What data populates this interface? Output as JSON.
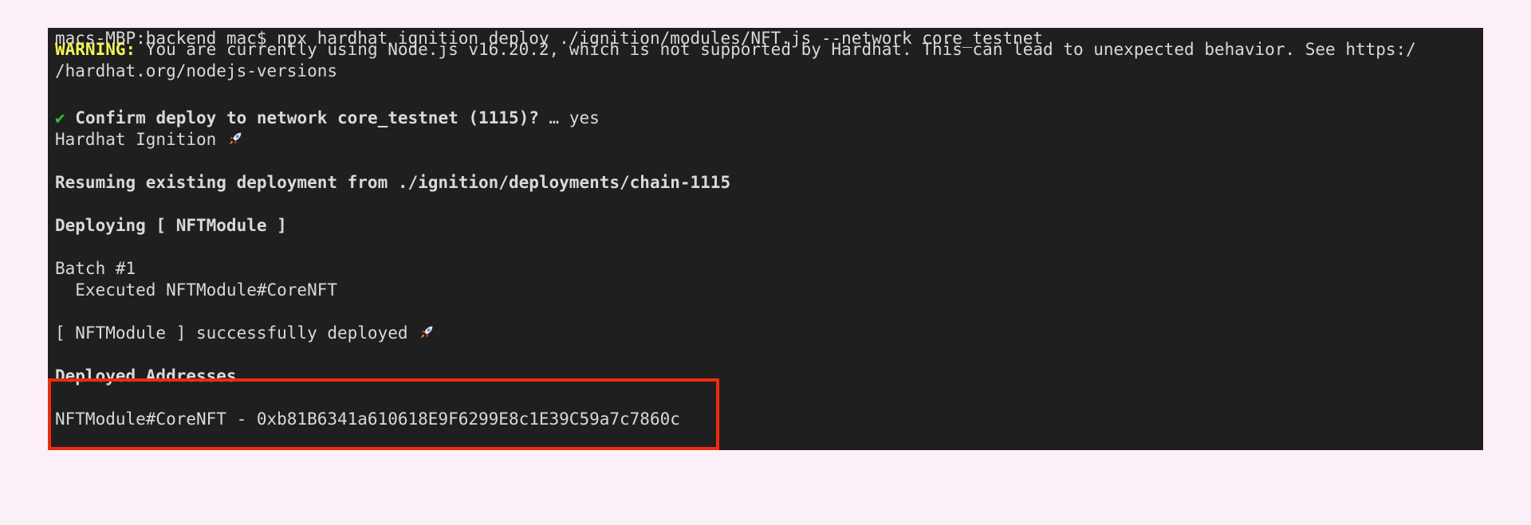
{
  "terminal": {
    "line1": "macs-MBP:backend mac$ npx hardhat ignition deploy ./ignition/modules/NFT.js --network core_testnet",
    "warning_label": "WARNING:",
    "warning_text": " You are currently using Node.js v16.20.2, which is not supported by Hardhat. This can lead to unexpected behavior. See https:/",
    "warning_cont": "/hardhat.org/nodejs-versions",
    "confirm_check": "✔",
    "confirm_text": " Confirm deploy to network core_testnet (1115)?",
    "confirm_answer": " … yes",
    "ignition_title": "Hardhat Ignition ",
    "resuming": "Resuming existing deployment from ./ignition/deployments/chain-1115",
    "deploying": "Deploying [ NFTModule ]",
    "batch": "Batch #1",
    "executed": "  Executed NFTModule#CoreNFT",
    "success": "[ NFTModule ] successfully deployed ",
    "deployed_addresses": "Deployed Addresses",
    "address_line": "NFTModule#CoreNFT - 0xb81B6341a610618E9F6299E8c1E39C59a7c7860c"
  },
  "icons": {
    "rocket": "rocket-icon",
    "check": "checkmark-icon"
  },
  "colors": {
    "background": "#1f1f1f",
    "warning": "#f3f35a",
    "check": "#36c236",
    "highlight": "#ee2b10"
  }
}
